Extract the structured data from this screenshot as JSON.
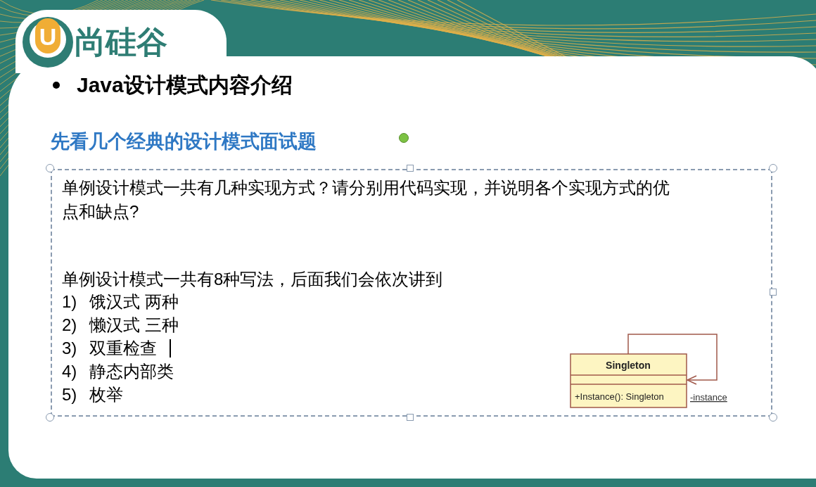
{
  "logo": {
    "letter": "U",
    "text": "尚硅谷"
  },
  "heading": "Java设计模式内容介绍",
  "subtitle": "先看几个经典的设计模式面试题",
  "text_box": {
    "selected": true
  },
  "question": "单例设计模式一共有几种实现方式？请分别用代码实现，并说明各个实现方式的优点和缺点?",
  "intro": "单例设计模式一共有8种写法，后面我们会依次讲到",
  "items": [
    {
      "number": "1)",
      "text": "饿汉式 两种",
      "caret": false
    },
    {
      "number": "2)",
      "text": "懒汉式 三种",
      "caret": false
    },
    {
      "number": "3)",
      "text": "双重检查",
      "caret": true
    },
    {
      "number": "4)",
      "text": "静态内部类",
      "caret": false
    },
    {
      "number": "5)",
      "text": "枚举",
      "caret": false
    }
  ],
  "uml": {
    "class_name": "Singleton",
    "method": "+Instance(): Singleton",
    "association_label": "-instance"
  }
}
